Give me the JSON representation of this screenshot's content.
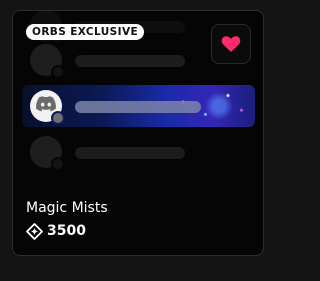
{
  "badge": {
    "label": "ORBS EXCLUSIVE"
  },
  "item": {
    "name": "Magic Mists",
    "price": "3500"
  },
  "icons": {
    "favorite": "heart-icon",
    "currency": "orb-icon",
    "avatar": "discord-logo-icon"
  },
  "colors": {
    "heart": "#ff2a6d",
    "accent_gradient_start": "#07102b",
    "accent_gradient_end": "#3426b8"
  }
}
